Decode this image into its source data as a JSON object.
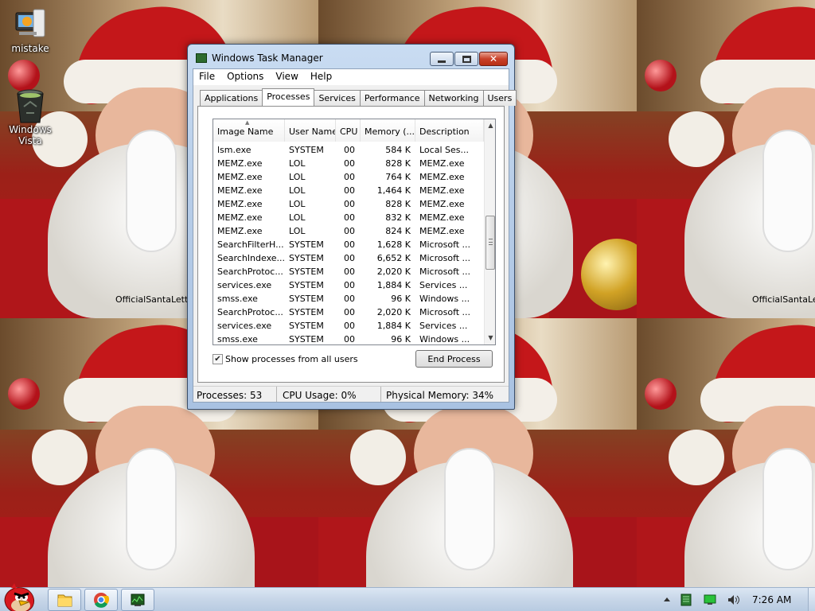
{
  "desktop": {
    "icons": [
      {
        "label": "mistake",
        "icon": "installer-icon"
      },
      {
        "label": "Windows Vista",
        "icon": "recycle-bin-icon"
      }
    ],
    "wallpaper_watermark": "OfficialSantaLetters"
  },
  "window": {
    "title": "Windows Task Manager",
    "menu": [
      "File",
      "Options",
      "View",
      "Help"
    ],
    "tabs": [
      "Applications",
      "Processes",
      "Services",
      "Performance",
      "Networking",
      "Users"
    ],
    "active_tab": "Processes",
    "columns": [
      "Image Name",
      "User Name",
      "CPU",
      "Memory (...",
      "Description"
    ],
    "sorted_column": "Image Name",
    "processes": [
      [
        "lsm.exe",
        "SYSTEM",
        "00",
        "584 K",
        "Local Ses..."
      ],
      [
        "MEMZ.exe",
        "LOL",
        "00",
        "828 K",
        "MEMZ.exe"
      ],
      [
        "MEMZ.exe",
        "LOL",
        "00",
        "764 K",
        "MEMZ.exe"
      ],
      [
        "MEMZ.exe",
        "LOL",
        "00",
        "1,464 K",
        "MEMZ.exe"
      ],
      [
        "MEMZ.exe",
        "LOL",
        "00",
        "828 K",
        "MEMZ.exe"
      ],
      [
        "MEMZ.exe",
        "LOL",
        "00",
        "832 K",
        "MEMZ.exe"
      ],
      [
        "MEMZ.exe",
        "LOL",
        "00",
        "824 K",
        "MEMZ.exe"
      ],
      [
        "SearchFilterH...",
        "SYSTEM",
        "00",
        "1,628 K",
        "Microsoft ..."
      ],
      [
        "SearchIndexe...",
        "SYSTEM",
        "00",
        "6,652 K",
        "Microsoft ..."
      ],
      [
        "SearchProtoc...",
        "SYSTEM",
        "00",
        "2,020 K",
        "Microsoft ..."
      ],
      [
        "services.exe",
        "SYSTEM",
        "00",
        "1,884 K",
        "Services ..."
      ],
      [
        "smss.exe",
        "SYSTEM",
        "00",
        "96 K",
        "Windows ..."
      ],
      [
        "SearchProtoc...",
        "SYSTEM",
        "00",
        "2,020 K",
        "Microsoft ..."
      ],
      [
        "services.exe",
        "SYSTEM",
        "00",
        "1,884 K",
        "Services ..."
      ],
      [
        "smss.exe",
        "SYSTEM",
        "00",
        "96 K",
        "Windows ..."
      ]
    ],
    "show_all_users": {
      "label": "Show processes from all users",
      "checked": true
    },
    "end_process_label": "End Process",
    "status": {
      "processes": "Processes: 53",
      "cpu": "CPU Usage: 0%",
      "memory": "Physical Memory: 34%"
    }
  },
  "taskbar": {
    "start_icon": "angry-bird-icon",
    "pinned": [
      "folder-icon",
      "chrome-icon",
      "task-manager-icon"
    ],
    "tray_icons": [
      "chevron-up-icon",
      "monitor-icon",
      "network-icon",
      "volume-icon"
    ],
    "clock": "7:26 AM"
  }
}
